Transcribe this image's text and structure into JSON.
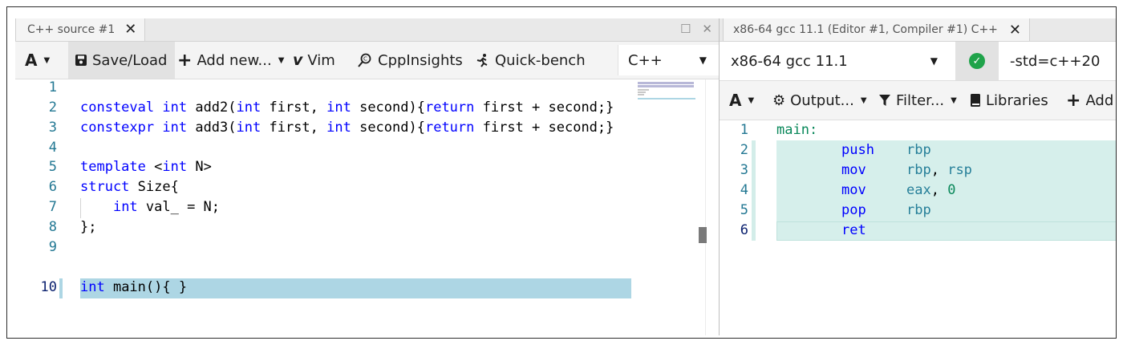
{
  "left_pane": {
    "tab_title": "C++ source #1",
    "toolbar": {
      "font_label": "A",
      "save_load": "Save/Load",
      "add_new": "Add new...",
      "vim": "Vim",
      "cppinsights": "CppInsights",
      "quick_bench": "Quick-bench",
      "language": "C++"
    },
    "line_numbers": [
      "1",
      "2",
      "3",
      "4",
      "5",
      "6",
      "7",
      "8",
      "9",
      "10"
    ],
    "code": {
      "l2": {
        "k1": "consteval",
        "k2": "int",
        "t1": " add2(",
        "k3": "int",
        "t2": " first, ",
        "k4": "int",
        "t3": " second){",
        "k5": "return",
        "t4": " first + second;}"
      },
      "l3": {
        "k1": "constexpr",
        "k2": "int",
        "t1": " add3(",
        "k3": "int",
        "t2": " first, ",
        "k4": "int",
        "t3": " second){",
        "k5": "return",
        "t4": " first + second;}"
      },
      "l5": {
        "k1": "template",
        "t1": " <",
        "k2": "int",
        "t2": " N>"
      },
      "l6": {
        "k1": "struct",
        "t1": " Size{"
      },
      "l7": {
        "ind": "    ",
        "k1": "int",
        "t1": " val_ = N;"
      },
      "l8": {
        "t1": "};"
      },
      "l10": {
        "k1": "int",
        "t1": " main(){ }"
      }
    }
  },
  "right_pane": {
    "tab_title": "x86-64 gcc 11.1 (Editor #1, Compiler #1) C++",
    "compiler": "x86-64 gcc 11.1",
    "flags": "-std=c++20",
    "toolbar": {
      "font_label": "A",
      "output": "Output...",
      "filter": "Filter...",
      "libraries": "Libraries",
      "add": "Add r"
    },
    "asm_line_numbers": [
      "1",
      "2",
      "3",
      "4",
      "5",
      "6"
    ],
    "asm": {
      "l1": {
        "label": "main:"
      },
      "l2": {
        "op": "push",
        "a1": "rbp"
      },
      "l3": {
        "op": "mov",
        "a1": "rbp",
        "sep": ", ",
        "a2": "rsp"
      },
      "l4": {
        "op": "mov",
        "a1": "eax",
        "sep": ", ",
        "a2": "0"
      },
      "l5": {
        "op": "pop",
        "a1": "rbp"
      },
      "l6": {
        "op": "ret"
      }
    }
  },
  "colors": {
    "keyword": "#0000ff",
    "line_number": "#237893",
    "current_line_bg": "#add6e4",
    "asm_highlight_bg": "#d6efeb",
    "success": "#1fa34a"
  }
}
